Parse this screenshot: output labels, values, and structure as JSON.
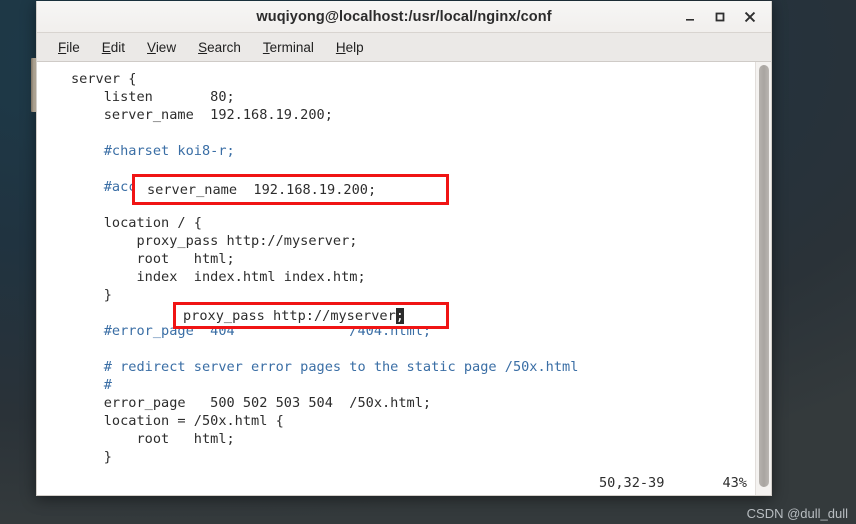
{
  "window": {
    "title": "wuqiyong@localhost:/usr/local/nginx/conf",
    "controls": {
      "minimize": "minimize-button",
      "maximize": "maximize-button",
      "close": "close-button"
    }
  },
  "menubar": {
    "items": [
      {
        "label": "File",
        "mnemonic": "F"
      },
      {
        "label": "Edit",
        "mnemonic": "E"
      },
      {
        "label": "View",
        "mnemonic": "V"
      },
      {
        "label": "Search",
        "mnemonic": "S"
      },
      {
        "label": "Terminal",
        "mnemonic": "T"
      },
      {
        "label": "Help",
        "mnemonic": "H"
      }
    ]
  },
  "editor": {
    "lines": [
      {
        "text": "server {",
        "type": "code"
      },
      {
        "text": "    listen       80;",
        "type": "code"
      },
      {
        "text": "    server_name  192.168.19.200;",
        "type": "code"
      },
      {
        "text": "",
        "type": "code"
      },
      {
        "text": "    #charset koi8-r;",
        "type": "comment"
      },
      {
        "text": "",
        "type": "code"
      },
      {
        "text": "    #access_log  logs/host.access.log  main;",
        "type": "comment"
      },
      {
        "text": "",
        "type": "code"
      },
      {
        "text": "    location / {",
        "type": "code"
      },
      {
        "text": "        proxy_pass http://myserver;",
        "type": "code"
      },
      {
        "text": "        root   html;",
        "type": "code"
      },
      {
        "text": "        index  index.html index.htm;",
        "type": "code"
      },
      {
        "text": "    }",
        "type": "code"
      },
      {
        "text": "",
        "type": "code"
      },
      {
        "text": "    #error_page  404              /404.html;",
        "type": "comment"
      },
      {
        "text": "",
        "type": "code"
      },
      {
        "text": "    # redirect server error pages to the static page /50x.html",
        "type": "comment"
      },
      {
        "text": "    #",
        "type": "comment"
      },
      {
        "text": "    error_page   500 502 503 504  /50x.html;",
        "type": "code"
      },
      {
        "text": "    location = /50x.html {",
        "type": "code"
      },
      {
        "text": "        root   html;",
        "type": "code"
      },
      {
        "text": "    }",
        "type": "code"
      }
    ],
    "highlighted": [
      {
        "text": "server_name  192.168.19.200;",
        "box_color": "#f01414"
      },
      {
        "text_before": "proxy_pass http://myserver",
        "cursor_char": ";",
        "box_color": "#f01414"
      }
    ],
    "status": {
      "position": "50,32-39",
      "percent": "43%"
    }
  },
  "watermark": {
    "text": "CSDN @dull_dull"
  },
  "colors": {
    "comment": "#3a6ea5",
    "code": "#2d2d2d",
    "annotation_box": "#f01414",
    "terminal_bg": "#ffffff",
    "chrome_bg": "#f6f5f4",
    "desktop_bg": "#203340"
  }
}
